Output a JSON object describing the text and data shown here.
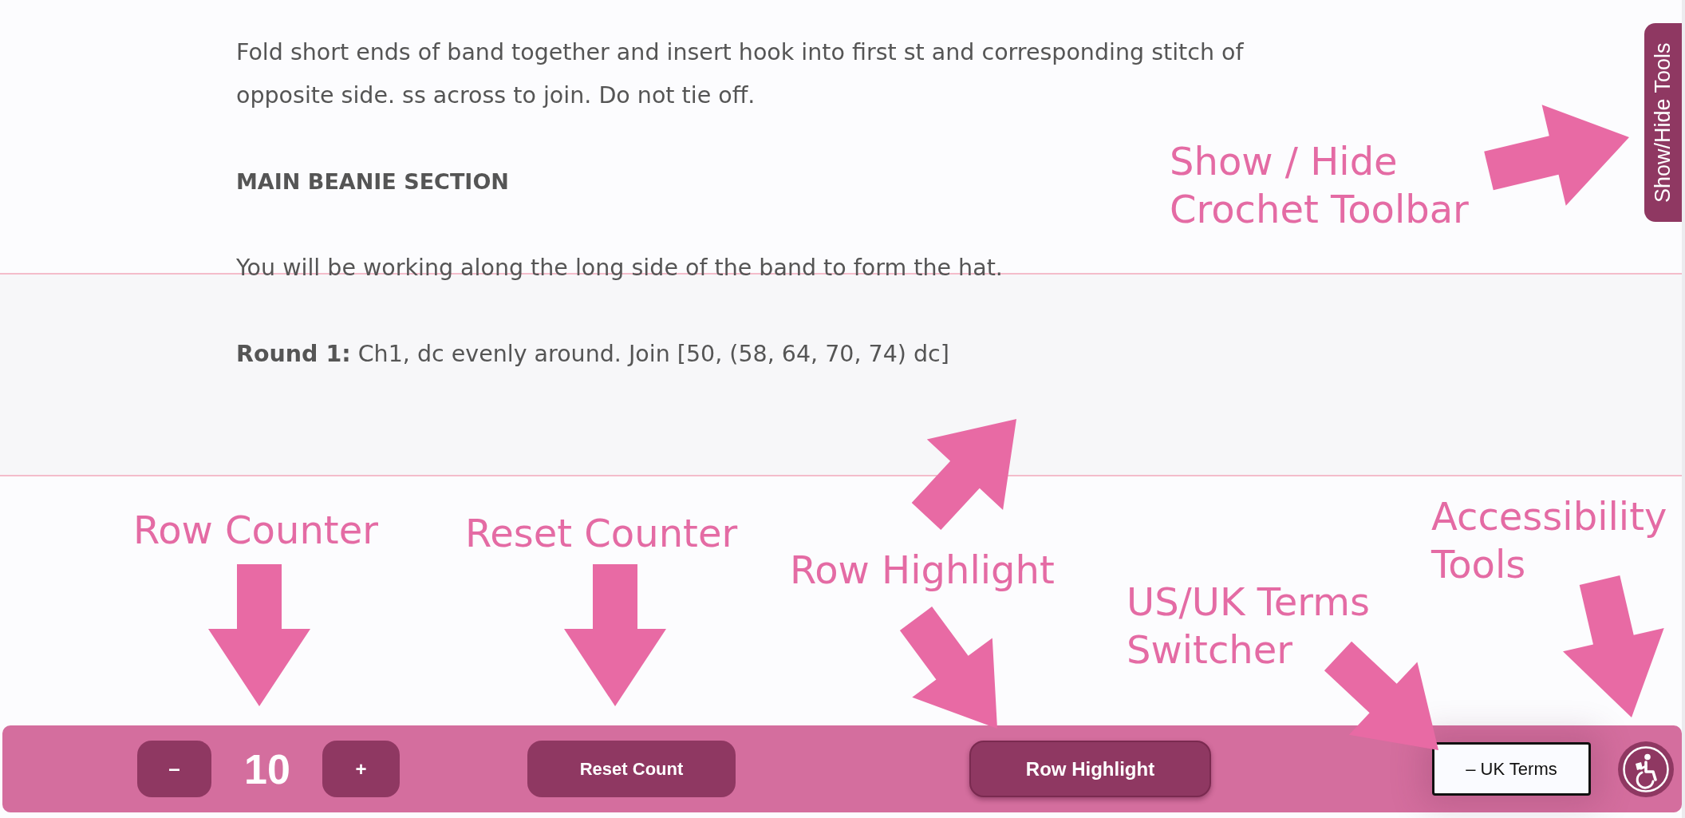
{
  "content": [
    {
      "kind": "paragraph",
      "text": "Fold short ends of band together and insert hook into first st and corresponding stitch of opposite side. ss across to join. Do not tie off."
    },
    {
      "kind": "heading",
      "text": "MAIN BEANIE SECTION"
    },
    {
      "kind": "paragraph",
      "text": "You will be working along the long side of the band to form the hat."
    },
    {
      "kind": "paragraph",
      "text": "**Round 1:** Ch1, dc evenly around. Join [50, (58, 64, 70, 74) dc]"
    }
  ],
  "annotations": [
    {
      "lines": [
        "Show / Hide",
        "Crochet Toolbar"
      ]
    },
    {
      "lines": [
        "Row Counter"
      ]
    },
    {
      "lines": [
        "Reset Counter"
      ]
    },
    {
      "lines": [
        "Row Highlight"
      ]
    },
    {
      "lines": [
        "US/UK Terms",
        "Switcher"
      ]
    },
    {
      "lines": [
        "Accessibility",
        "Tools"
      ]
    }
  ],
  "side_tab": {
    "label": "Show/Hide Tools"
  },
  "toolbar": {
    "counter": {
      "decrement": "–",
      "value": "10",
      "increment": "+"
    },
    "buttons": [
      {
        "kind": "reset",
        "label": "Reset Count"
      },
      {
        "kind": "toggle",
        "label": "Row Highlight",
        "on": true
      },
      {
        "kind": "terms",
        "label": "– UK Terms"
      }
    ]
  }
}
